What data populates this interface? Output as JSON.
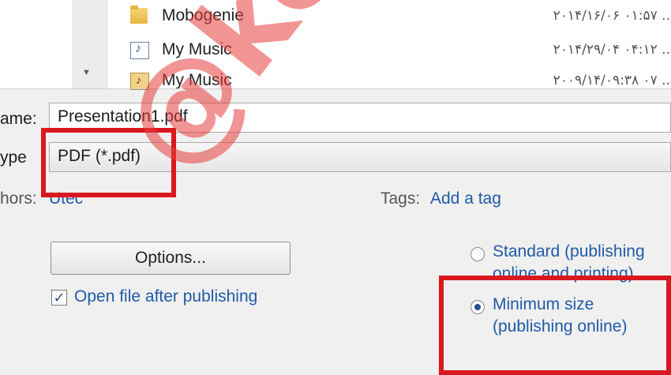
{
  "files": [
    {
      "name": "Mobogenie",
      "date": "٢٠١۴/١۶/٠۶ ٠١:۵٧ ..",
      "icon": "folder-icon"
    },
    {
      "name": "My Music",
      "date": "٢٠١۴/٢٩/٠۴ ٠۴:١٢ ..",
      "icon": "music-shortcut-icon"
    },
    {
      "name": "My Music",
      "date": "٢٠٠٩/١۴/٠٧ ٠٩:٣٨ ..",
      "icon": "music-folder-icon"
    }
  ],
  "form": {
    "filename_label": "ame:",
    "filename_value": "Presentation1.pdf",
    "type_label": "ype",
    "type_value": "PDF (*.pdf)",
    "authors_label": "hors:",
    "authors_value": "Utec",
    "tags_label": "Tags:",
    "tags_value": "Add a tag"
  },
  "options": {
    "options_button": "Options...",
    "open_after_label": "Open file after publishing",
    "open_after_checked": true
  },
  "optimize": {
    "standard_line1": "Standard (publishing",
    "standard_line2": "online and printing)",
    "minimum_line1": "Minimum size",
    "minimum_line2": "(publishing online)",
    "selected": "minimum"
  },
  "watermark": "@kooye",
  "colors": {
    "highlight": "#d9191f",
    "link": "#1f5aa6"
  }
}
